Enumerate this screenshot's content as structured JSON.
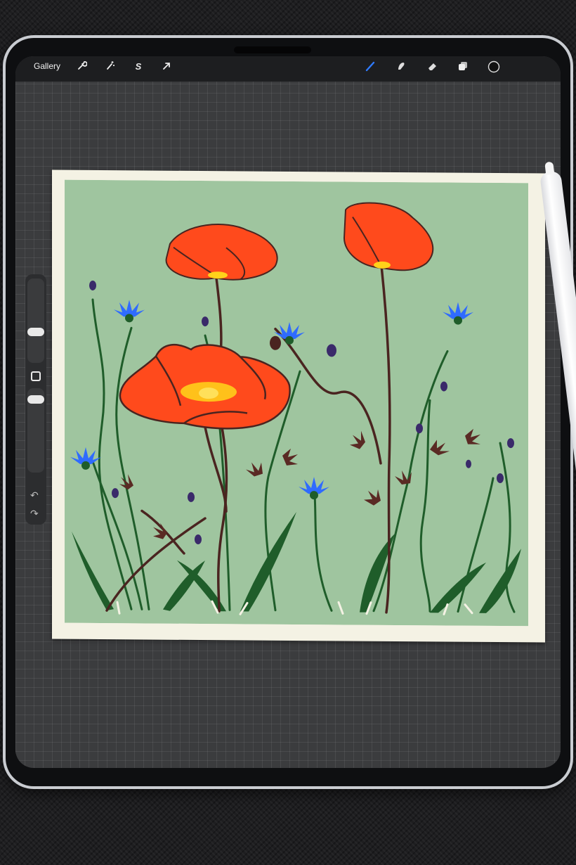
{
  "topbar": {
    "gallery_label": "Gallery",
    "left_tools": [
      "wrench-icon",
      "magic-wand-icon",
      "selection-icon",
      "transform-arrow-icon"
    ],
    "right_tools": [
      "brush-icon",
      "smudge-icon",
      "eraser-icon",
      "layers-icon",
      "color-picker-icon"
    ]
  },
  "sidebar": {
    "tools": [
      "brush-size-slider",
      "modify-button",
      "opacity-slider",
      "undo-icon",
      "redo-icon"
    ]
  },
  "colors": {
    "canvas_background": "#9fc59f",
    "poppy": "#ff4a1c",
    "cornflower": "#2f6bff",
    "stem_green": "#1f5d2a",
    "stem_brown": "#4a2420",
    "accent_blue": "#2f7bff"
  }
}
